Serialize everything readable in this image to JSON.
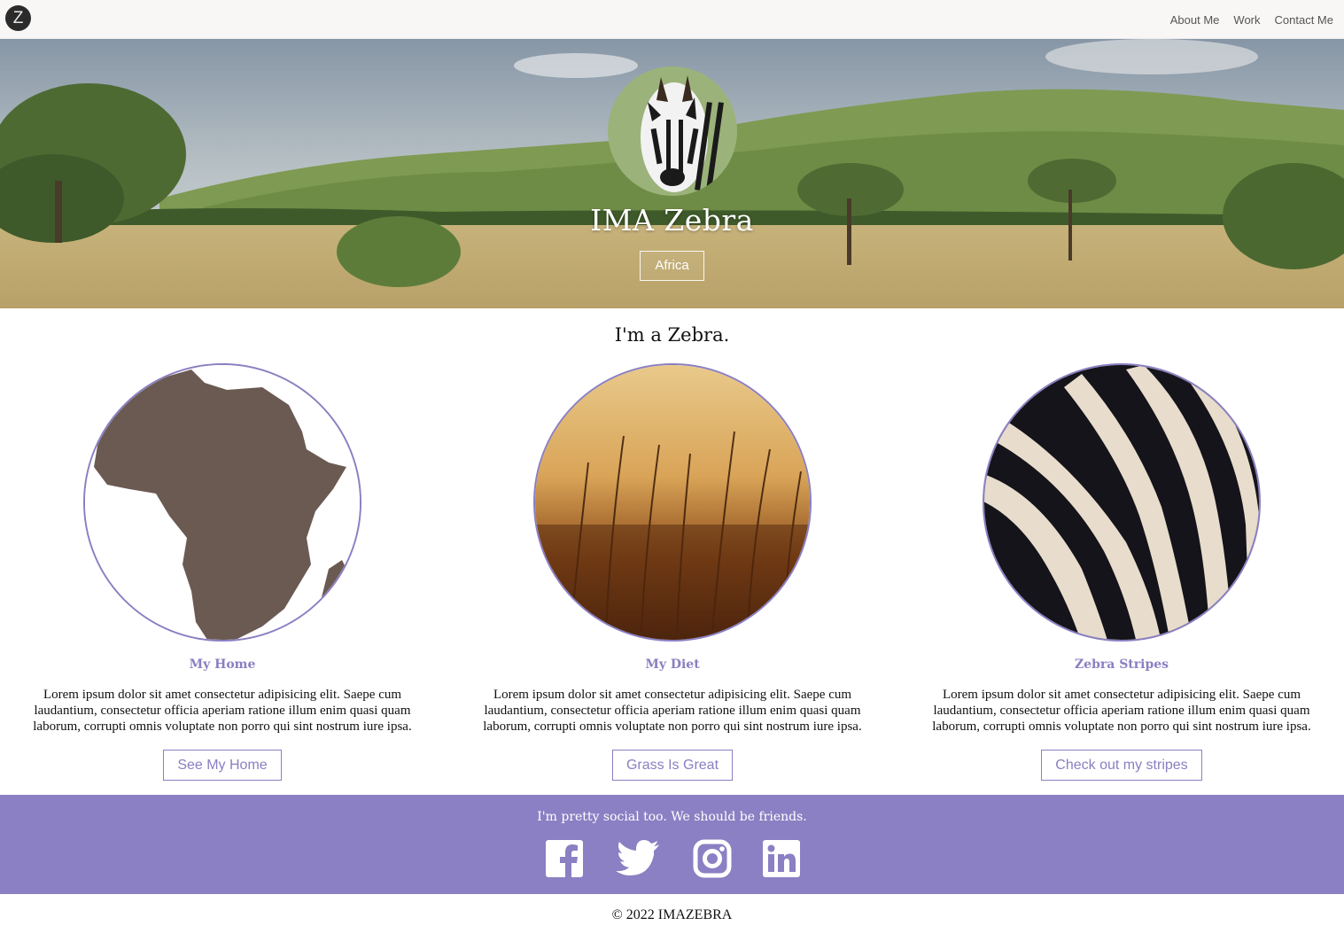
{
  "nav": {
    "logo": "Z",
    "links": [
      "About Me",
      "Work",
      "Contact Me"
    ]
  },
  "hero": {
    "title": "IMA Zebra",
    "button": "Africa"
  },
  "main": {
    "heading": "I'm a Zebra.",
    "cards": [
      {
        "title": "My Home",
        "text": "Lorem ipsum dolor sit amet consectetur adipisicing elit. Saepe cum laudantium, consectetur officia aperiam ratione illum enim quasi quam laborum, corrupti omnis voluptate non porro qui sint nostrum iure ipsa.",
        "button": "See My Home"
      },
      {
        "title": "My Diet",
        "text": "Lorem ipsum dolor sit amet consectetur adipisicing elit. Saepe cum laudantium, consectetur officia aperiam ratione illum enim quasi quam laborum, corrupti omnis voluptate non porro qui sint nostrum iure ipsa.",
        "button": "Grass Is Great"
      },
      {
        "title": "Zebra Stripes",
        "text": "Lorem ipsum dolor sit amet consectetur adipisicing elit. Saepe cum laudantium, consectetur officia aperiam ratione illum enim quasi quam laborum, corrupti omnis voluptate non porro qui sint nostrum iure ipsa.",
        "button": "Check out my stripes"
      }
    ]
  },
  "social": {
    "text": "I'm pretty social too. We should be friends.",
    "icons": [
      "facebook-icon",
      "twitter-icon",
      "instagram-icon",
      "linkedin-icon"
    ]
  },
  "footer": {
    "text": "© 2022 IMAZEBRA"
  },
  "colors": {
    "accent": "#8a80c3",
    "nav_bg": "#f8f7f5",
    "africa_fill": "#6b5a52"
  }
}
